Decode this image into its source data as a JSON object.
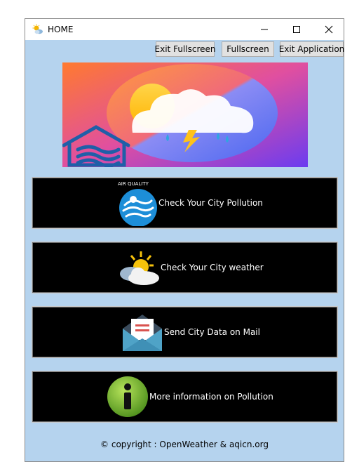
{
  "window": {
    "title": "HOME"
  },
  "toolbar": {
    "exit_fullscreen": "Exit Fullscreen",
    "fullscreen": "Fullscreen",
    "exit_application": "Exit Application"
  },
  "menu": {
    "pollution_badge": "AIR QUALITY",
    "pollution": "Check Your City Pollution",
    "weather": "Check Your City weather",
    "mail": "Send City Data on Mail",
    "info": "More information on Pollution"
  },
  "footer": {
    "copyright": "© copyright : OpenWeather & aqicn.org"
  },
  "colors": {
    "window_bg": "#b5d3ee",
    "button_bg": "#000000",
    "button_text": "#ffffff"
  },
  "icons": [
    "weather-app-icon",
    "minimize-icon",
    "maximize-icon",
    "close-icon",
    "air-quality-icon",
    "sun-cloud-icon",
    "mail-envelope-icon",
    "info-icon"
  ]
}
